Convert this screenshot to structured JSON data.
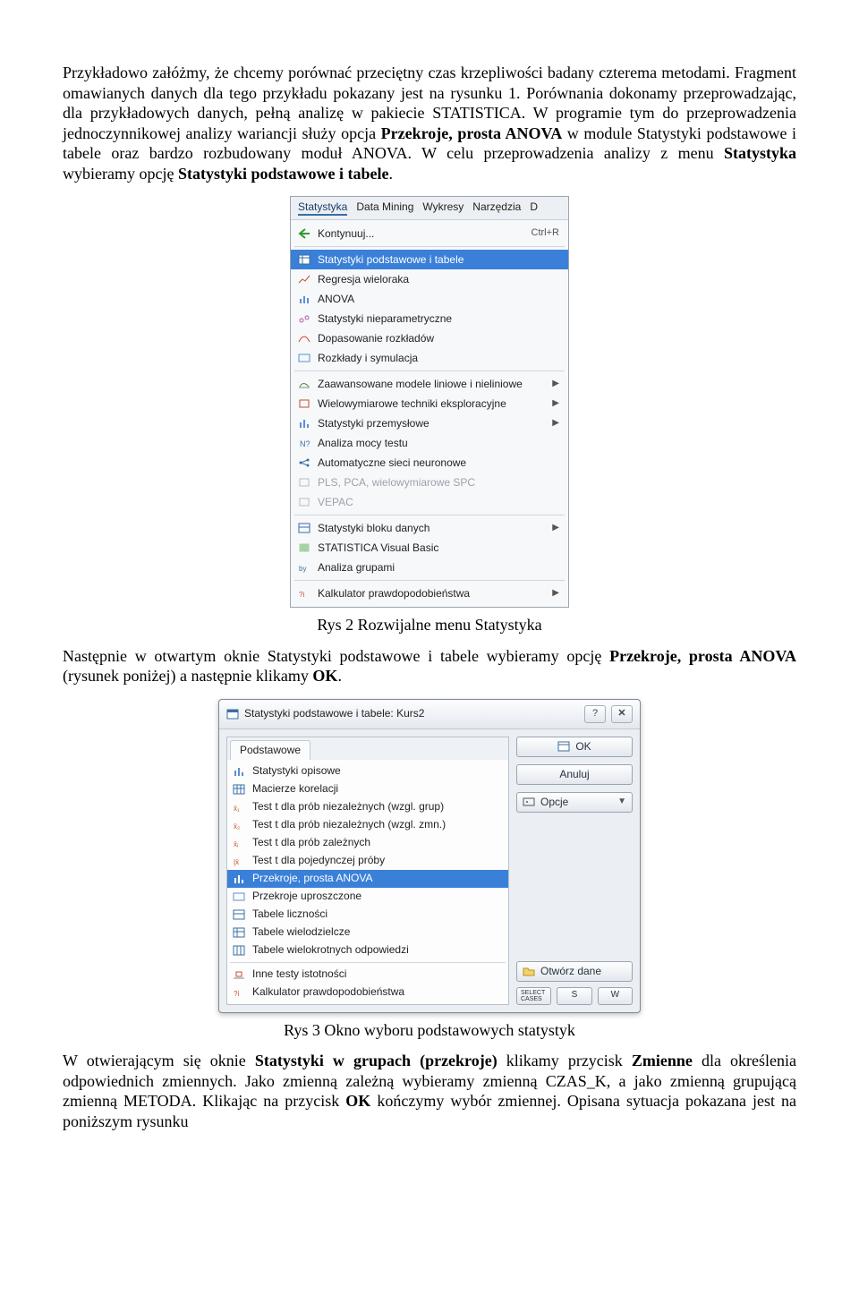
{
  "paragraphs": {
    "p1_a": "Przykładowo załóżmy, że chcemy porównać przeciętny czas krzepliwości badany czterema metodami. Fragment omawianych danych dla tego przykładu pokazany jest na rysunku 1. Porównania dokonamy przeprowadzając, dla przykładowych danych, pełną analizę w pakiecie STATISTICA. W programie tym do przeprowadzenia jednoczynnikowej analizy wariancji służy opcja ",
    "p1_b": "Przekroje, prosta ANOVA",
    "p1_c": " w module S",
    "p1_d": "tatystyki podstawowe i tabele",
    "p1_e": " oraz bardzo rozbudowany moduł ANOVA. W celu przeprowadzenia analizy z menu ",
    "p1_f": "Statystyka",
    "p1_g": " wybieramy opcję ",
    "p1_h": "Statystyki podstawowe i tabele",
    "p1_i": "."
  },
  "caption1": "Rys 2 Rozwijalne menu Statystyka",
  "p2_a": "Następnie w otwartym oknie Statystyki podstawowe i tabele wybieramy opcję ",
  "p2_b": "Przekroje, prosta ANOVA",
  "p2_c": " (rysunek poniżej) a następnie klikamy ",
  "p2_d": "OK",
  "p2_e": ".",
  "caption2": "Rys 3 Okno wyboru podstawowych statystyk",
  "p3_a": "W otwierającym się oknie ",
  "p3_b": "Statystyki w grupach (przekroje)",
  "p3_c": " klikamy przycisk ",
  "p3_d": "Zmienne",
  "p3_e": " dla określenia odpowiednich zmiennych. Jako zmienną zależną wybieramy zmienną CZAS_K, a jako zmienną grupującą zmienną METODA. Klikając na przycisk ",
  "p3_f": "OK",
  "p3_g": " kończymy wybór zmiennej. Opisana sytuacja pokazana jest na poniższym rysunku",
  "menu": {
    "tabs": [
      "Statystyka",
      "Data Mining",
      "Wykresy",
      "Narzędzia",
      "D"
    ],
    "continue": "Kontynuuj...",
    "continue_sc": "Ctrl+R",
    "items": [
      {
        "label": "Statystyki podstawowe i tabele",
        "selected": true
      },
      {
        "label": "Regresja wieloraka"
      },
      {
        "label": "ANOVA"
      },
      {
        "label": "Statystyki nieparametryczne"
      },
      {
        "label": "Dopasowanie rozkładów"
      },
      {
        "label": "Rozkłady i symulacja"
      }
    ],
    "items2": [
      {
        "label": "Zaawansowane modele liniowe i nieliniowe",
        "sub": true
      },
      {
        "label": "Wielowymiarowe techniki eksploracyjne",
        "sub": true
      },
      {
        "label": "Statystyki przemysłowe",
        "sub": true
      },
      {
        "label": "Analiza mocy testu"
      },
      {
        "label": "Automatyczne sieci neuronowe"
      },
      {
        "label": "PLS, PCA, wielowymiarowe SPC",
        "disabled": true
      },
      {
        "label": "VEPAC",
        "disabled": true
      }
    ],
    "items3": [
      {
        "label": "Statystyki bloku danych",
        "sub": true
      },
      {
        "label": "STATISTICA Visual Basic"
      },
      {
        "label": "Analiza grupami"
      }
    ],
    "items4": [
      {
        "label": "Kalkulator prawdopodobieństwa",
        "sub": true
      }
    ]
  },
  "dialog": {
    "title": "Statystyki podstawowe i tabele: Kurs2",
    "tab": "Podstawowe",
    "list": [
      {
        "label": "Statystyki opisowe"
      },
      {
        "label": "Macierze korelacji"
      },
      {
        "label": "Test t dla prób niezależnych (wzgl. grup)"
      },
      {
        "label": "Test t dla prób niezależnych (wzgl. zmn.)"
      },
      {
        "label": "Test t dla prób zależnych"
      },
      {
        "label": "Test t dla pojedynczej próby"
      },
      {
        "label": "Przekroje, prosta ANOVA",
        "selected": true
      },
      {
        "label": "Przekroje uproszczone"
      },
      {
        "label": "Tabele liczności"
      },
      {
        "label": "Tabele wielodzielcze"
      },
      {
        "label": "Tabele wielokrotnych odpowiedzi"
      }
    ],
    "list2": [
      {
        "label": "Inne testy istotności"
      },
      {
        "label": "Kalkulator prawdopodobieństwa"
      }
    ],
    "buttons": {
      "ok": "OK",
      "cancel": "Anuluj",
      "options": "Opcje",
      "open": "Otwórz dane",
      "select": "SELECT CASES",
      "s": "S",
      "w": "W"
    }
  }
}
